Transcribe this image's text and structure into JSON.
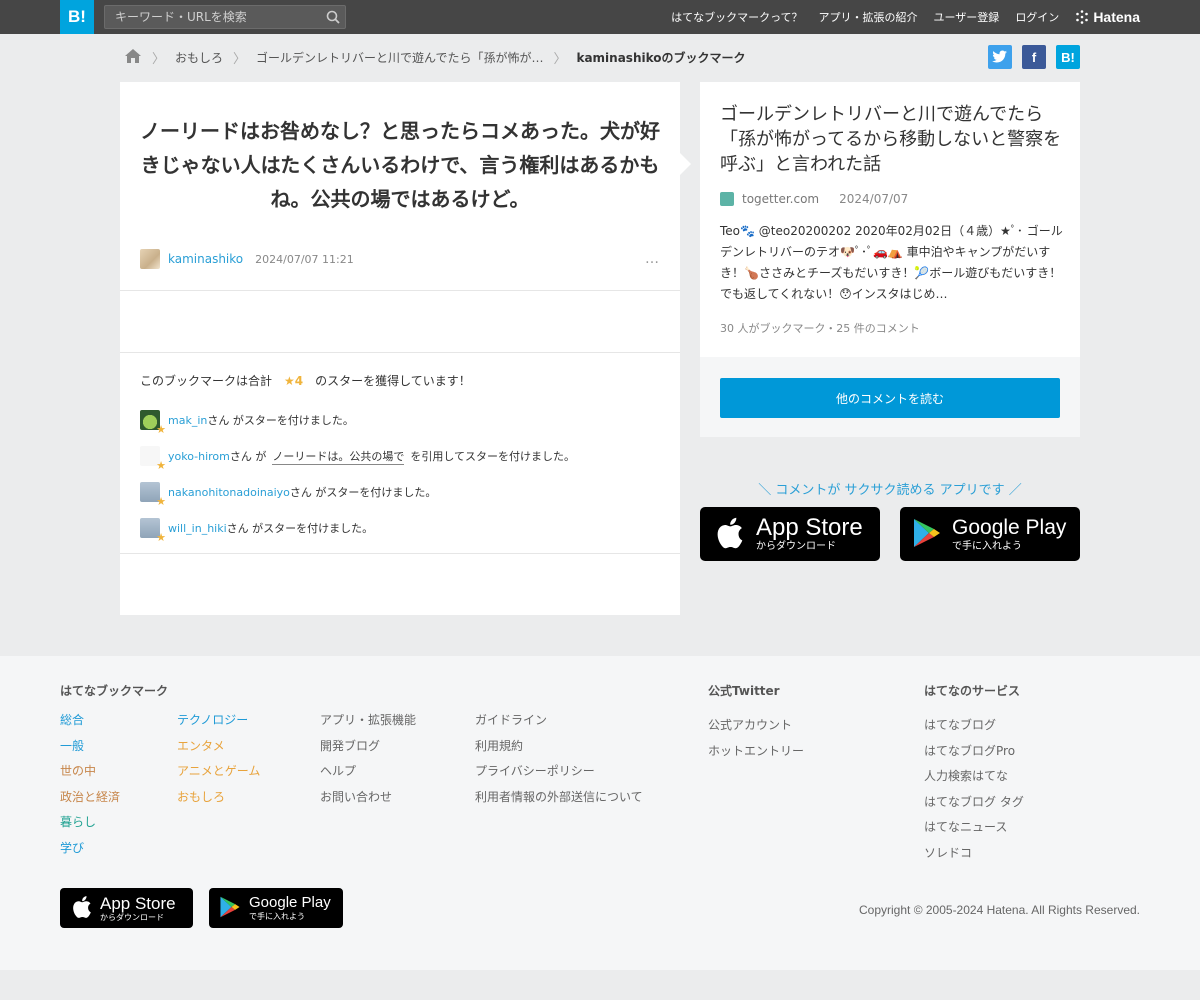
{
  "header": {
    "logo": "B!",
    "search_placeholder": "キーワード・URLを検索",
    "nav": [
      "はてなブックマークって？",
      "アプリ・拡張の紹介",
      "ユーザー登録",
      "ログイン"
    ],
    "brand": "Hatena"
  },
  "breadcrumb": {
    "items": [
      "おもしろ",
      "ゴールデンレトリバーと川で遊んでたら「孫が怖が…"
    ],
    "current": "kaminashikoのブックマーク"
  },
  "comment": {
    "text": "ノーリードはお咎めなし？と思ったらコメあった。犬が好きじゃない人はたくさんいるわけで、言う権利はあるかもね。公共の場ではあるけど。",
    "user": "kaminashiko",
    "date": "2024/07/07 11:21",
    "more": "…"
  },
  "stars": {
    "prefix": "このブックマークは合計",
    "count": "★4",
    "suffix": "のスターを獲得しています！",
    "rows": [
      {
        "user": "mak_in",
        "text": "さん がスターを付けました。"
      },
      {
        "user": "yoko-hirom",
        "text_a": "さん が",
        "quote": "ノーリードは。公共の場で",
        "text_b": "を引用してスターを付けました。"
      },
      {
        "user": "nakanohitonadoinaiyo",
        "text": "さん がスターを付けました。"
      },
      {
        "user": "will_in_hiki",
        "text": "さん がスターを付けました。"
      }
    ]
  },
  "entry": {
    "title": "ゴールデンレトリバーと川で遊んでたら「孫が怖がってるから移動しないと警察を呼ぶ」と言われた話",
    "source": "togetter.com",
    "date": "2024/07/07",
    "description": "Teo🐾 @teo20200202 2020年02月02日（４歳）★ﾟ･ ゴールデンレトリバーのテオ🐶ﾟ･ﾟ🚗⛺ 車中泊やキャンプがだいすき！🍗ささみとチーズもだいすき！🎾ボール遊びもだいすき！でも返してくれない！😯インスタはじめ…",
    "count": "30 人がブックマーク・25 件のコメント",
    "read_button": "他のコメントを読む"
  },
  "promo": "＼ コメントが サクサク読める アプリです ／",
  "stores": {
    "app_store": {
      "big": "App Store",
      "small": "からダウンロード"
    },
    "google_play": {
      "big": "Google Play",
      "small": "で手に入れよう"
    }
  },
  "footer": {
    "col1_title": "はてなブックマーク",
    "cats_a": [
      "総合",
      "一般",
      "世の中",
      "政治と経済",
      "暮らし",
      "学び"
    ],
    "cats_b": [
      "テクノロジー",
      "エンタメ",
      "アニメとゲーム",
      "おもしろ"
    ],
    "links_c": [
      "アプリ・拡張機能",
      "開発ブログ",
      "ヘルプ",
      "お問い合わせ"
    ],
    "links_d": [
      "ガイドライン",
      "利用規約",
      "プライバシーポリシー",
      "利用者情報の外部送信について"
    ],
    "twitter_title": "公式Twitter",
    "twitter_links": [
      "公式アカウント",
      "ホットエントリー"
    ],
    "services_title": "はてなのサービス",
    "services": [
      "はてなブログ",
      "はてなブログPro",
      "人力検索はてな",
      "はてなブログ タグ",
      "はてなニュース",
      "ソレドコ"
    ],
    "copyright": "Copyright © 2005-2024 Hatena. All Rights Reserved."
  },
  "colors": {
    "accent": "#00a4de",
    "link": "#2a9fd6",
    "star": "#f0b43c",
    "cat_blue": "#1e9ad6",
    "cat_orange": "#e8a33c",
    "cat_teal": "#23a393",
    "cat_brown": "#c7864a"
  }
}
